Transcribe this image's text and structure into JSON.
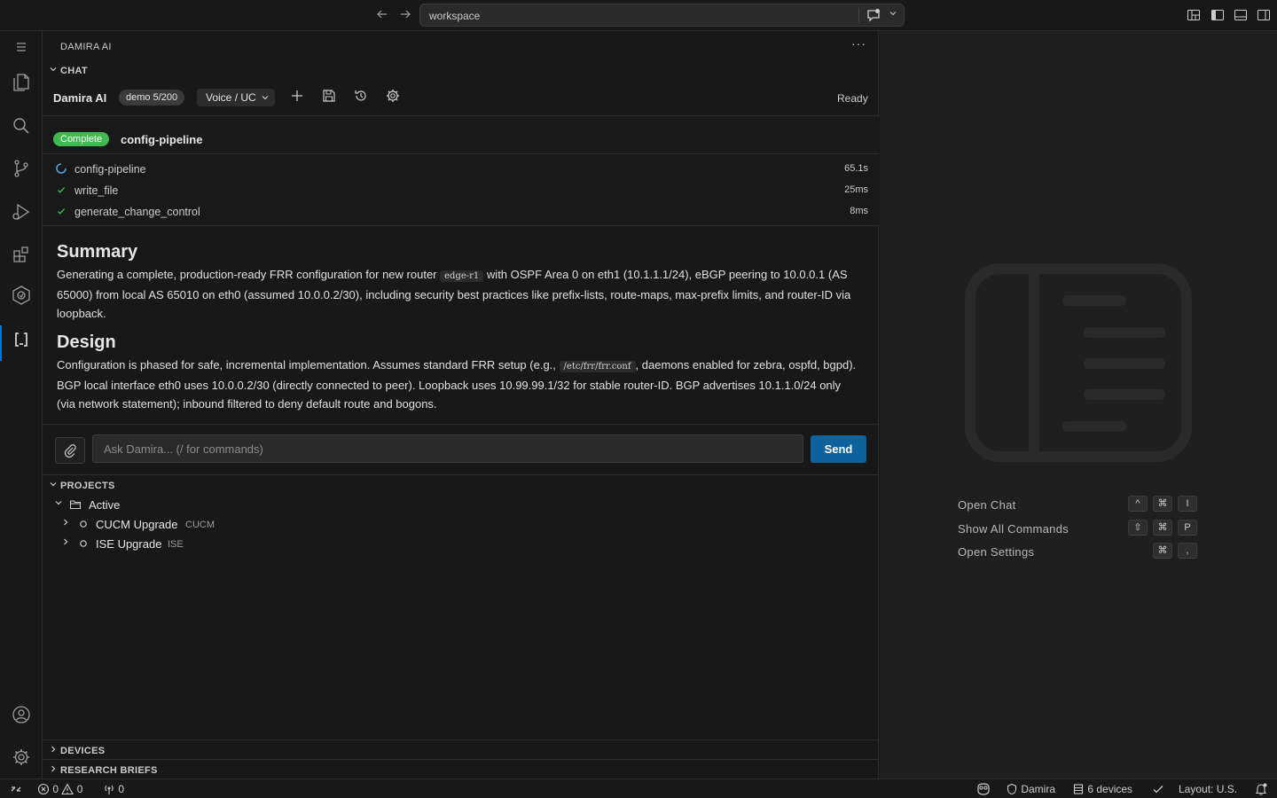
{
  "titlebar": {
    "back_icon": "arrow-left-icon",
    "forward_icon": "arrow-right-icon",
    "command_center_text": "workspace"
  },
  "activity_bar": {
    "items": [
      {
        "name": "menu-icon"
      },
      {
        "name": "explorer-icon"
      },
      {
        "name": "search-icon"
      },
      {
        "name": "source-control-icon"
      },
      {
        "name": "run-debug-icon"
      },
      {
        "name": "extensions-icon"
      },
      {
        "name": "damira-icon"
      },
      {
        "name": "bracket-icon",
        "active": true
      }
    ],
    "bottom": [
      {
        "name": "account-icon"
      },
      {
        "name": "settings-gear-icon"
      }
    ]
  },
  "panel": {
    "title": "DAMIRA AI",
    "more": "···"
  },
  "chat": {
    "section_title": "CHAT",
    "brand": "Damira AI",
    "demo_badge": "demo 5/200",
    "mode": "Voice / UC",
    "status": "Ready",
    "run": {
      "status": "Complete",
      "name": "config-pipeline",
      "steps": [
        {
          "label": "config-pipeline",
          "duration": "65.1s",
          "state": "running"
        },
        {
          "label": "write_file",
          "duration": "25ms",
          "state": "done"
        },
        {
          "label": "generate_change_control",
          "duration": "8ms",
          "state": "done"
        }
      ]
    },
    "summary": {
      "heading": "Summary",
      "text_1": "Generating a complete, production-ready FRR configuration for new router",
      "code_1": "edge-r1",
      "text_2": "with OSPF Area 0 on eth1 (10.1.1.1/24), eBGP peering to 10.0.0.1 (AS 65000) from local AS 65010 on eth0 (assumed 10.0.0.2/30), including security best practices like prefix-lists, route-maps, max-prefix limits, and router-ID via loopback."
    },
    "design": {
      "heading": "Design",
      "text_1": "Configuration is phased for safe, incremental implementation. Assumes standard FRR setup (e.g.,",
      "code_1": "/etc/frr/frr.conf",
      "text_2": ", daemons enabled for zebra, ospfd, bgpd). BGP local interface eth0 uses 10.0.0.2/30 (directly connected to peer). Loopback uses 10.99.99.1/32 for stable router-ID. BGP advertises 10.1.1.0/24 only (via network statement); inbound filtered to deny default route and bogons."
    },
    "input": {
      "placeholder": "Ask Damira... (/ for commands)",
      "value": "",
      "send_label": "Send"
    }
  },
  "projects": {
    "section_title": "PROJECTS",
    "group": "Active",
    "items": [
      {
        "label": "CUCM Upgrade",
        "tag": "CUCM"
      },
      {
        "label": "ISE Upgrade",
        "tag": "ISE"
      }
    ]
  },
  "devices": {
    "section_title": "DEVICES"
  },
  "research": {
    "section_title": "RESEARCH BRIEFS"
  },
  "editor": {
    "shortcuts": [
      {
        "label": "Open Chat",
        "keys": [
          "^",
          "⌘",
          "I"
        ]
      },
      {
        "label": "Show All Commands",
        "keys": [
          "⇧",
          "⌘",
          "P"
        ]
      },
      {
        "label": "Open Settings",
        "keys": [
          "⌘",
          ","
        ]
      }
    ]
  },
  "statusbar": {
    "errors": "0",
    "warnings": "0",
    "ports": "0",
    "account": "Damira",
    "devices": "6 devices",
    "layout": "Layout: U.S."
  },
  "colors": {
    "accent": "#0078d4",
    "send_button": "#0e639c",
    "complete": "#3fb950",
    "spinner": "#4fa3e0"
  }
}
